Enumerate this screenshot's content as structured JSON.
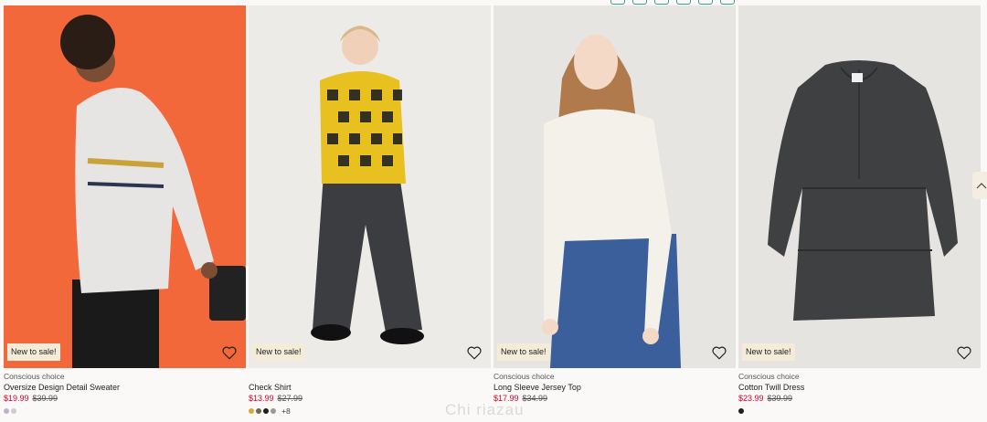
{
  "products": [
    {
      "badge": "New to sale!",
      "conscious": "Conscious choice",
      "name": "Oversize Design Detail Sweater",
      "price_sale": "$19.99",
      "price_old": "$39.99",
      "swatches": [
        "#bfb2c4",
        "#d6c6cf"
      ],
      "more": ""
    },
    {
      "badge": "New to sale!",
      "conscious": "",
      "name": "Check Shirt",
      "price_sale": "$13.99",
      "price_old": "$27.99",
      "swatches": [
        "#d6a83a",
        "#6b6a55",
        "#1f1f1f",
        "#9a9a9a"
      ],
      "more": "+8"
    },
    {
      "badge": "New to sale!",
      "conscious": "Conscious choice",
      "name": "Long Sleeve Jersey Top",
      "price_sale": "$17.99",
      "price_old": "$34.99",
      "swatches": [],
      "more": ""
    },
    {
      "badge": "New to sale!",
      "conscious": "Conscious choice",
      "name": "Cotton Twill Dress",
      "price_sale": "$23.99",
      "price_old": "$39.99",
      "swatches": [
        "#1f1f1f"
      ],
      "more": ""
    }
  ],
  "icons": {
    "wishlist": "heart-icon",
    "scroll": "arrow-up-icon"
  },
  "colors": {
    "sale_price": "#d6002a",
    "badge_bg": "#f4ecd9",
    "page_bg": "#faf9f8"
  },
  "watermark": "Chi  riazau"
}
